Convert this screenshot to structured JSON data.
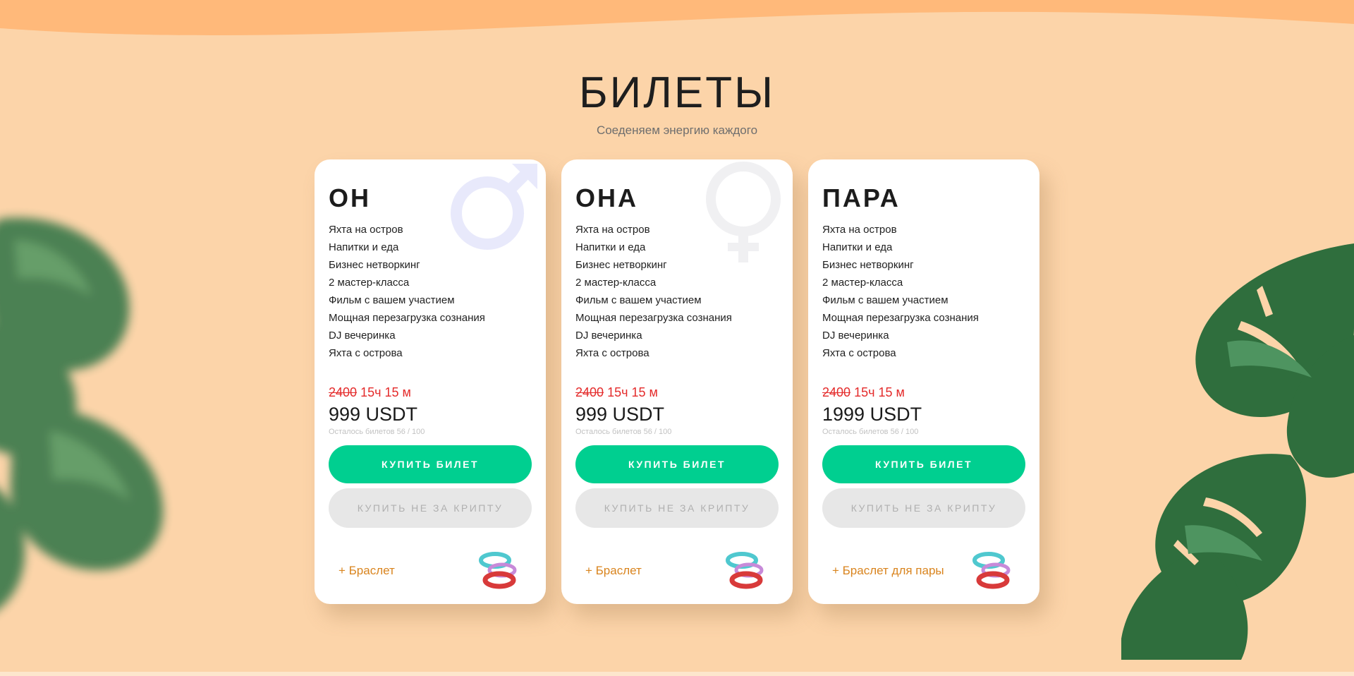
{
  "section": {
    "title": "БИЛЕТЫ",
    "subtitle": "Соеденяем энергию каждого"
  },
  "colors": {
    "background": "#fcd4a9",
    "accent_green": "#00cf90",
    "old_price_red": "#e42b2b",
    "bracelet_orange": "#d9841e"
  },
  "cards": [
    {
      "title": "ОН",
      "symbol_icon": "male-symbol-icon",
      "features": [
        "Яхта на остров",
        "Напитки и еда",
        "Бизнес нетворкинг",
        "2 мастер-класса",
        "Фильм с вашем участием",
        "Мощная перезагрузка сознания",
        "DJ вечеринка",
        "Яхта с острова"
      ],
      "old_price": "2400",
      "timer": "15ч 15 м",
      "price": "999 USDT",
      "remaining": "Осталось билетов 56 / 100",
      "buy_label": "КУПИТЬ БИЛЕТ",
      "alt_label": "КУПИТЬ НЕ ЗА КРИПТУ",
      "bracelet_label": "+ Браслет"
    },
    {
      "title": "ОНА",
      "symbol_icon": "female-symbol-icon",
      "features": [
        "Яхта на остров",
        "Напитки и еда",
        "Бизнес нетворкинг",
        "2 мастер-класса",
        "Фильм с вашем участием",
        "Мощная перезагрузка сознания",
        "DJ вечеринка",
        "Яхта с острова"
      ],
      "old_price": "2400",
      "timer": "15ч 15 м",
      "price": "999 USDT",
      "remaining": "Осталось билетов 56 / 100",
      "buy_label": "КУПИТЬ БИЛЕТ",
      "alt_label": "КУПИТЬ НЕ ЗА КРИПТУ",
      "bracelet_label": "+ Браслет"
    },
    {
      "title": "ПАРА",
      "symbol_icon": "",
      "features": [
        "Яхта на остров",
        "Напитки и еда",
        "Бизнес нетворкинг",
        "2 мастер-класса",
        "Фильм с вашем участием",
        "Мощная перезагрузка сознания",
        "DJ вечеринка",
        "Яхта с острова"
      ],
      "old_price": "2400",
      "timer": "15ч 15 м",
      "price": "1999 USDT",
      "remaining": "Осталось билетов 56 / 100",
      "buy_label": "КУПИТЬ БИЛЕТ",
      "alt_label": "КУПИТЬ НЕ ЗА КРИПТУ",
      "bracelet_label": "+ Браслет для пары"
    }
  ]
}
